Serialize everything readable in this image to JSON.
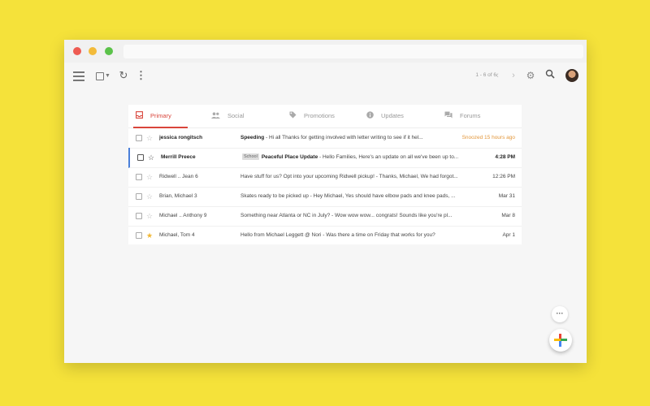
{
  "pager": {
    "text": "1 - 6 of 6"
  },
  "icons": {
    "refresh": "↻",
    "more_vert": "⋮",
    "prev": "‹",
    "next": "›",
    "gear": "⚙",
    "more_horiz": "···"
  },
  "tabs": [
    {
      "label": "Primary",
      "icon": "inbox-icon",
      "active": true
    },
    {
      "label": "Social",
      "icon": "people-icon",
      "active": false
    },
    {
      "label": "Promotions",
      "icon": "tag-icon",
      "active": false
    },
    {
      "label": "Updates",
      "icon": "info-icon",
      "active": false
    },
    {
      "label": "Forums",
      "icon": "chat-icon",
      "active": false
    }
  ],
  "emails": [
    {
      "sender": "jessica rongitsch",
      "tag": "",
      "subject": "Speeding",
      "snippet": " - Hi all Thanks for getting involved with letter writing to see if it hel...",
      "date": "Snoozed 15 hours ago",
      "bold": true
    },
    {
      "sender": "Merrill Preece",
      "tag": "School",
      "subject": "Peaceful Place Update",
      "snippet": " - Hello Families, Here's an update on all we've been up to...",
      "date": "4:28 PM",
      "bold": true
    },
    {
      "sender": "Ridwell .. Jean 6",
      "tag": "",
      "subject": "Have stuff for us? Opt into your upcoming Ridwell pickup!",
      "snippet": " - Thanks, Michael, We had forgot...",
      "date": "12:26 PM",
      "bold": false
    },
    {
      "sender": "Brian, Michael 3",
      "tag": "",
      "subject": "Skates ready to be picked up",
      "snippet": " - Hey Michael, Yes should have elbow pads and knee pads, ...",
      "date": "Mar 31",
      "bold": false
    },
    {
      "sender": "Michael .. Anthony 9",
      "tag": "",
      "subject": "Something near Atlanta or NC in July?",
      "snippet": " - Wow wow wow... congrats! Sounds like you're pl...",
      "date": "Mar 8",
      "bold": false
    },
    {
      "sender": "Michael, Tom 4",
      "tag": "",
      "subject": "Hello from Michael Leggett @ Nori",
      "snippet": " - Was there a time on Friday that works for you?",
      "date": "Apr 1",
      "bold": false
    }
  ],
  "colors": {
    "background": "#f5e23a",
    "accent_red": "#d9453b",
    "snoozed": "#e3973b",
    "focus": "#4a7fd9",
    "star_gold": "#f1b631"
  }
}
